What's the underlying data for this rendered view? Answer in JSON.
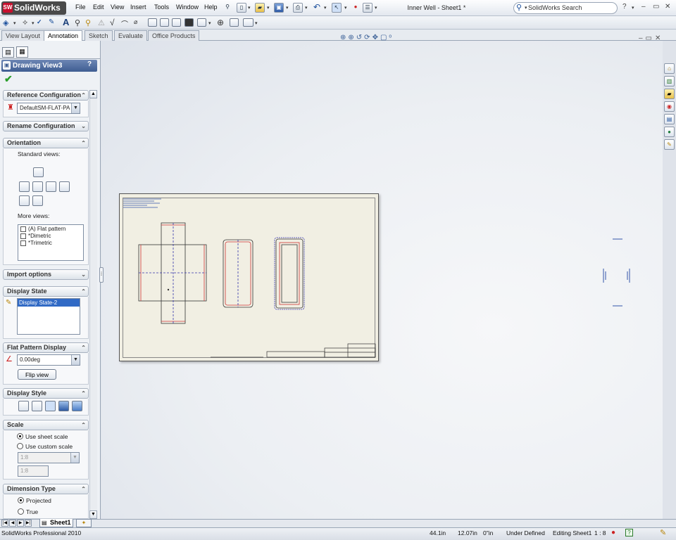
{
  "app": {
    "name": "SolidWorks",
    "logo_mark": "SW",
    "document_title": "Inner Well - Sheet1 *"
  },
  "menu": [
    "File",
    "Edit",
    "View",
    "Insert",
    "Tools",
    "Window",
    "Help"
  ],
  "search": {
    "placeholder": "SolidWorks Search"
  },
  "window_controls": {
    "help": "?",
    "minimize": "–",
    "restore": "▭",
    "close": "✕"
  },
  "tabs": [
    {
      "label": "View Layout",
      "active": false
    },
    {
      "label": "Annotation",
      "active": true
    },
    {
      "label": "Sketch",
      "active": false
    },
    {
      "label": "Evaluate",
      "active": false
    },
    {
      "label": "Office Products",
      "active": false
    }
  ],
  "property_manager": {
    "title": "Drawing View3",
    "help": "?",
    "ok": "✔",
    "sections": {
      "reference_configuration": {
        "title": "Reference Configuration",
        "value": "DefaultSM-FLAT-PA"
      },
      "rename_configuration": {
        "title": "Rename Configuration"
      },
      "orientation": {
        "title": "Orientation",
        "standard_views_label": "Standard views:",
        "more_views_label": "More views:",
        "more_views": [
          "(A) Flat pattern",
          "*Dimetric",
          "*Trimetric"
        ]
      },
      "import_options": {
        "title": "Import options"
      },
      "display_state": {
        "title": "Display State",
        "items": [
          "Display State-2"
        ]
      },
      "flat_pattern_display": {
        "title": "Flat Pattern Display",
        "angle": "0.00deg",
        "flip_button": "Flip view"
      },
      "display_style": {
        "title": "Display Style"
      },
      "scale": {
        "title": "Scale",
        "use_sheet_scale": "Use sheet scale",
        "use_custom_scale": "Use custom scale",
        "custom_scale_value": "1:8",
        "custom_scale_text": "1:8"
      },
      "dimension_type": {
        "title": "Dimension Type",
        "projected": "Projected",
        "true": "True"
      }
    }
  },
  "sheet_tabs": [
    "Sheet1"
  ],
  "status_bar": {
    "product": "SolidWorks Professional 2010",
    "x": "44.1in",
    "y": "12.07in",
    "z": "0\"in",
    "state": "Under Defined",
    "editing": "Editing Sheet1",
    "scale": "1 : 8"
  },
  "colors": {
    "accent": "#3f5d92",
    "ok": "#2a9d2a",
    "brand": "#c8102e",
    "sheet": "#f1efe3"
  }
}
